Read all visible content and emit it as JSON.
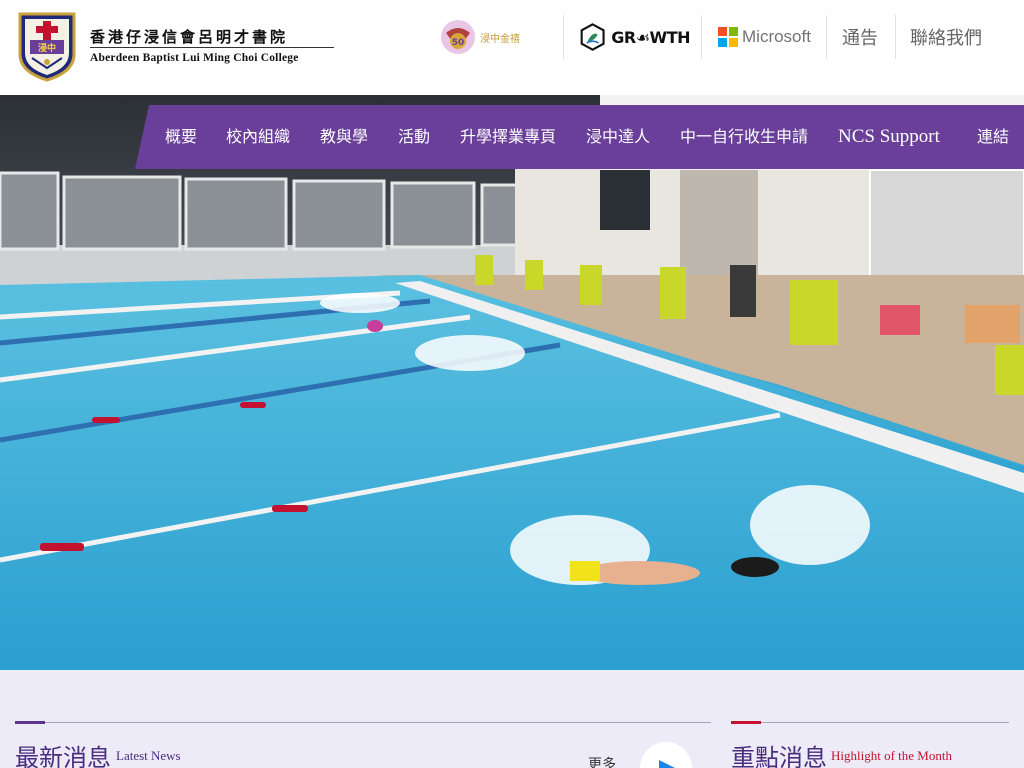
{
  "header": {
    "school_name_cn": "香港仔浸信會呂明才書院",
    "school_name_en": "Aberdeen Baptist Lui Ming Choi College",
    "crest_icon": "school-crest-icon",
    "partners": [
      {
        "icon": "golden-jubilee-icon",
        "label": "浸中金禧"
      },
      {
        "icon": "growth-logo-icon",
        "label": "GR☙WTH"
      },
      {
        "icon": "microsoft-logo-icon",
        "label": "Microsoft"
      }
    ],
    "links": [
      {
        "label": "通告"
      },
      {
        "label": "聯絡我們"
      }
    ]
  },
  "nav": {
    "items": [
      {
        "label": "概要"
      },
      {
        "label": "校內組織"
      },
      {
        "label": "教與學"
      },
      {
        "label": "活動"
      },
      {
        "label": "升學擇業專頁"
      },
      {
        "label": "浸中達人"
      },
      {
        "label": "中一自行收生申請"
      },
      {
        "label": "NCS Support"
      },
      {
        "label": "連結"
      }
    ]
  },
  "hero": {
    "image_icon": "swimming-pool-photo"
  },
  "news": {
    "title": "最新消息",
    "subtitle": "Latest News",
    "more_label": "更多",
    "more_icon": "arrow-right-icon"
  },
  "highlight": {
    "title": "重點消息",
    "subtitle": "Highlight of the Month"
  },
  "colors": {
    "brand_purple": "#6a3f9a",
    "title_purple": "#4a2d7f",
    "accent_red": "#c3122f",
    "bg_lavender": "#ecebf7",
    "ms_red": "#f25022",
    "ms_green": "#7fba00",
    "ms_blue": "#00a4ef",
    "ms_yellow": "#ffb900"
  }
}
